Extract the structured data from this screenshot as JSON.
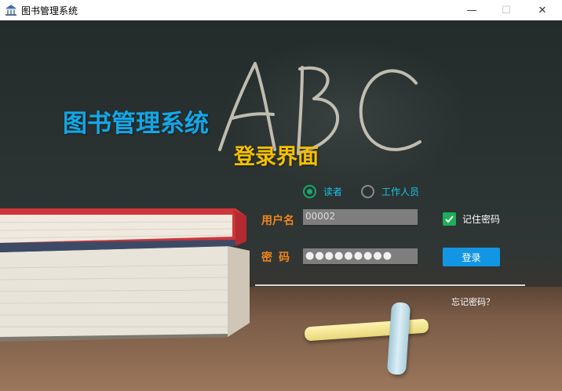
{
  "window": {
    "title": "图书管理系统",
    "controls": {
      "minimize": "—",
      "maximize": "☐",
      "close": "✕"
    }
  },
  "headings": {
    "system_title": "图书管理系统",
    "login_title": "登录界面"
  },
  "role": {
    "options": [
      "读者",
      "工作人员"
    ],
    "selected": "读者"
  },
  "form": {
    "username_label": "用户名",
    "username_value": "00002",
    "password_label": "密码",
    "password_value": "●●●●●●●●●",
    "remember_label": "记住密码",
    "remember_checked": true,
    "login_button": "登录",
    "forgot_link": "忘记密码？"
  },
  "colors": {
    "system_title": "#13a7e8",
    "login_title": "#f6c000",
    "field_label": "#f0861c",
    "radio_selected": "#19a86a",
    "login_button": "#1296e3",
    "checkbox": "#1fae5a"
  },
  "icons": {
    "app": "library-icon",
    "checkbox": "checkmark-icon"
  }
}
